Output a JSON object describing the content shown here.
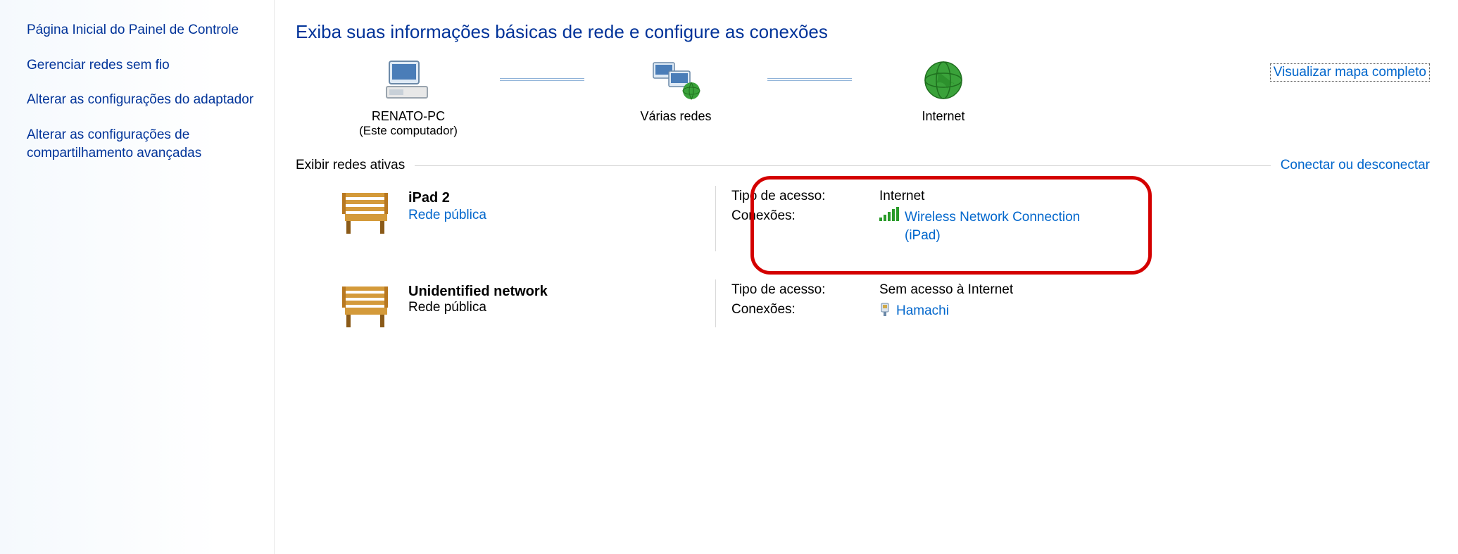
{
  "sidebar": {
    "links": [
      "Página Inicial do Painel de Controle",
      "Gerenciar redes sem fio",
      "Alterar as configurações do adaptador",
      "Alterar as configurações de compartilhamento avançadas"
    ]
  },
  "main": {
    "title": "Exiba suas informações básicas de rede e configure as conexões",
    "view_map": "Visualizar mapa completo",
    "map": {
      "node1": "RENATO-PC",
      "node1_sub": "(Este computador)",
      "node2": "Várias redes",
      "node3": "Internet"
    },
    "active_section": {
      "label": "Exibir redes ativas",
      "action": "Conectar ou desconectar"
    },
    "labels": {
      "access_type": "Tipo de acesso:",
      "connections": "Conexões:"
    },
    "networks": [
      {
        "name": "iPad  2",
        "type": "Rede pública",
        "type_is_link": true,
        "access": "Internet",
        "connection": "Wireless Network Connection (iPad)",
        "conn_icon": "signal",
        "highlighted": true
      },
      {
        "name": "Unidentified network",
        "type": "Rede pública",
        "type_is_link": false,
        "access": "Sem acesso à Internet",
        "connection": "Hamachi",
        "conn_icon": "plug",
        "highlighted": false
      }
    ]
  }
}
